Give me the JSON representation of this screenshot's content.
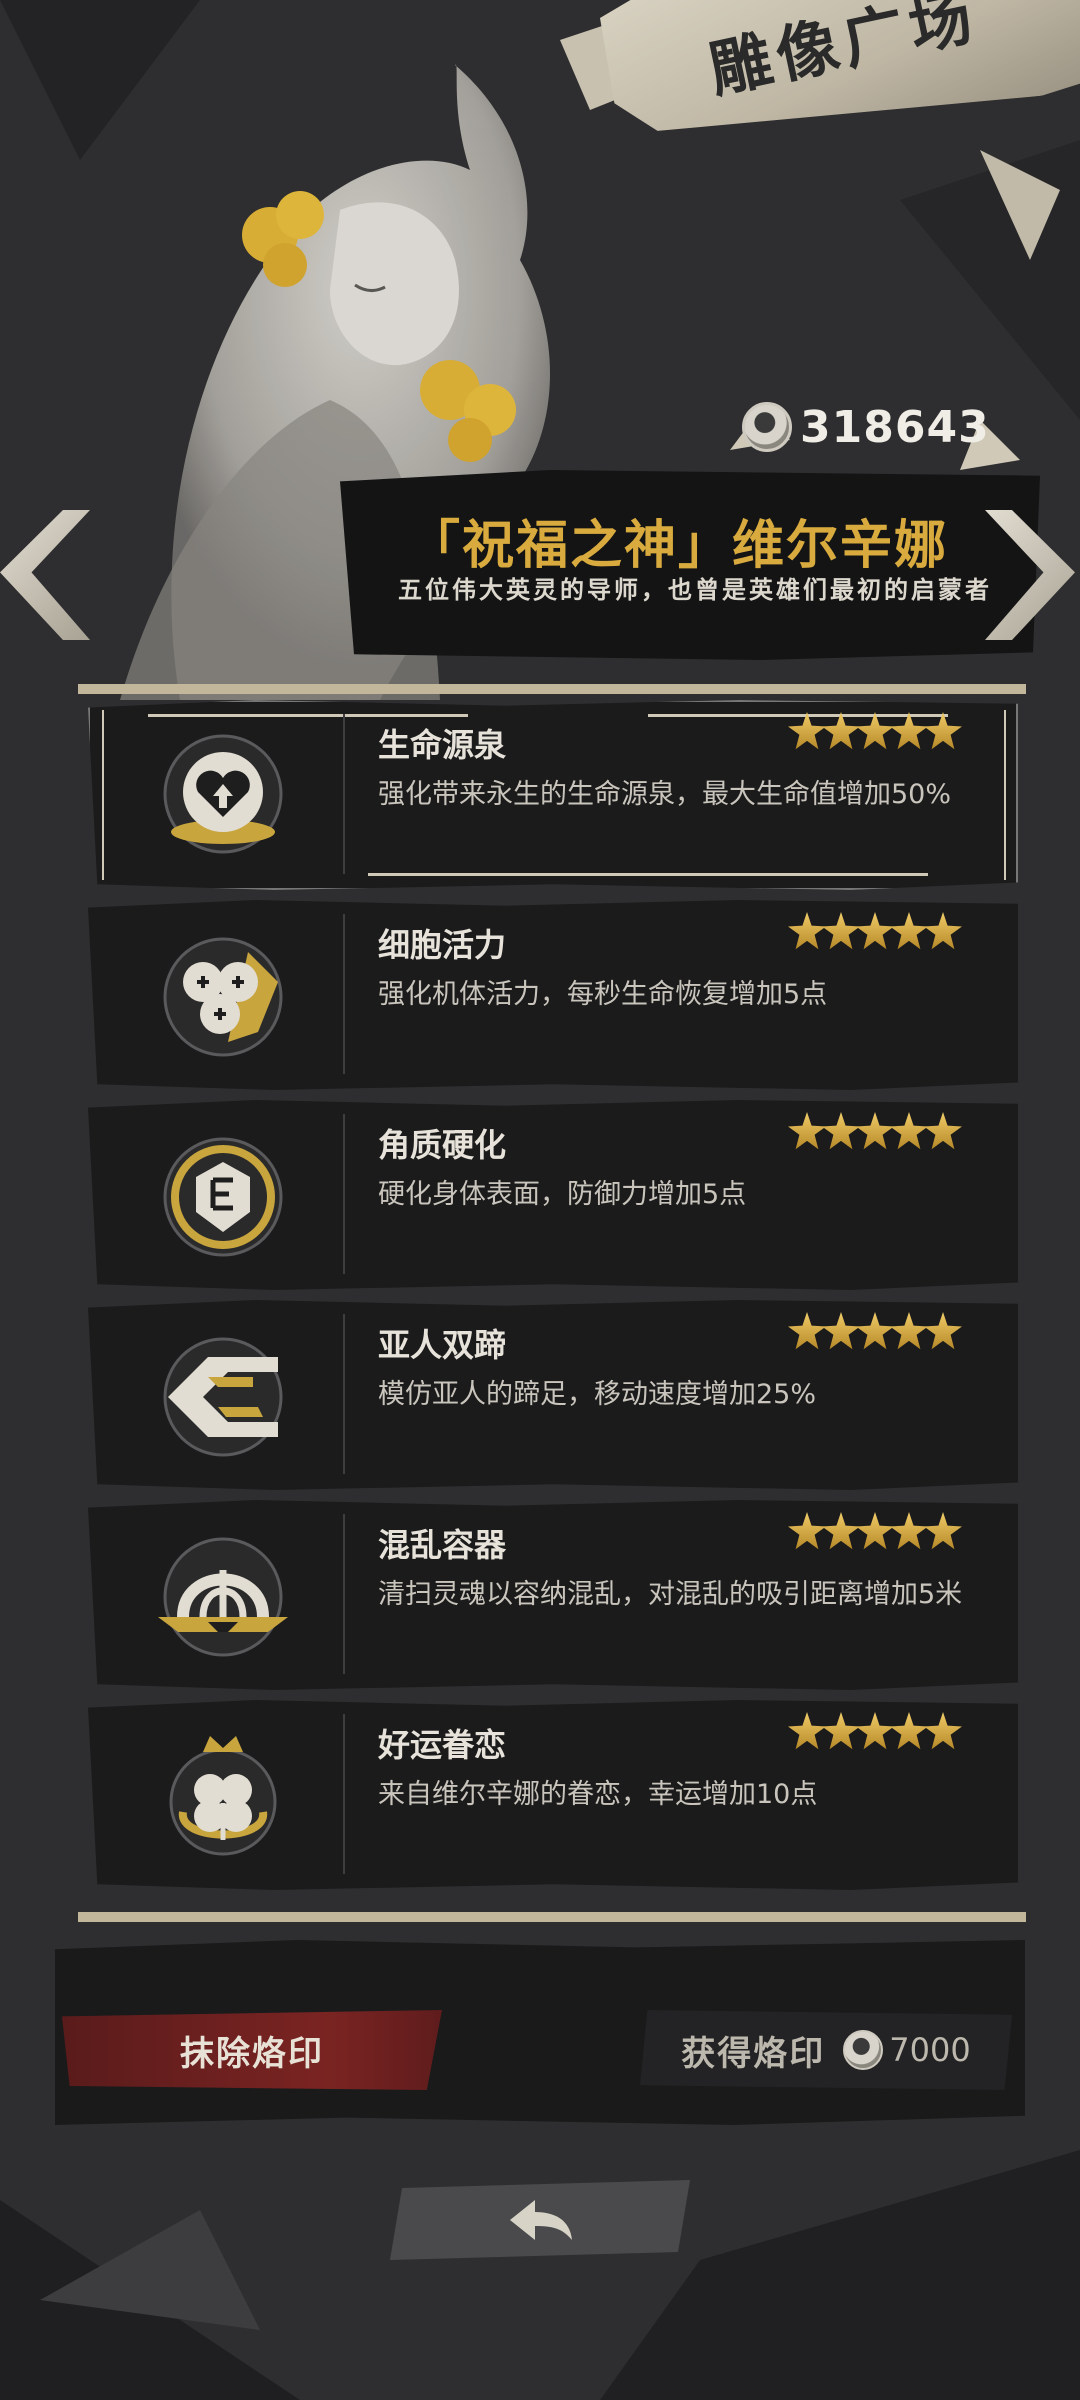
{
  "header": {
    "title": "雕像广场"
  },
  "currency": {
    "icon": "coin-icon",
    "value": "318643"
  },
  "statue": {
    "name": "「祝福之神」维尔辛娜",
    "description": "五位伟大英灵的导师，也曾是英雄们最初的启蒙者"
  },
  "navigation": {
    "prev": "chevron-left-icon",
    "next": "chevron-right-icon"
  },
  "skills": [
    {
      "name": "生命源泉",
      "description": "强化带来永生的生命源泉，最大生命值增加50%",
      "stars": 5,
      "icon": "heart-fountain-icon",
      "selected": true
    },
    {
      "name": "细胞活力",
      "description": "强化机体活力，每秒生命恢复增加5点",
      "stars": 5,
      "icon": "cells-icon",
      "selected": false
    },
    {
      "name": "角质硬化",
      "description": "硬化身体表面，防御力增加5点",
      "stars": 5,
      "icon": "shield-icon",
      "selected": false
    },
    {
      "name": "亚人双蹄",
      "description": "模仿亚人的蹄足，移动速度增加25%",
      "stars": 5,
      "icon": "hoof-icon",
      "selected": false
    },
    {
      "name": "混乱容器",
      "description": "清扫灵魂以容纳混乱，对混乱的吸引距离增加5米",
      "stars": 5,
      "icon": "vessel-icon",
      "selected": false
    },
    {
      "name": "好运眷恋",
      "description": "来自维尔辛娜的眷恋，幸运增加10点",
      "stars": 5,
      "icon": "clover-crown-icon",
      "selected": false
    }
  ],
  "actions": {
    "erase_label": "抹除烙印",
    "obtain_label": "获得烙印",
    "obtain_cost": "7000"
  },
  "back": {
    "icon": "back-arrow-icon"
  },
  "colors": {
    "accent_gold": "#d9ab3e",
    "erase_red": "#7a2422",
    "panel": "#1b1b1c"
  }
}
